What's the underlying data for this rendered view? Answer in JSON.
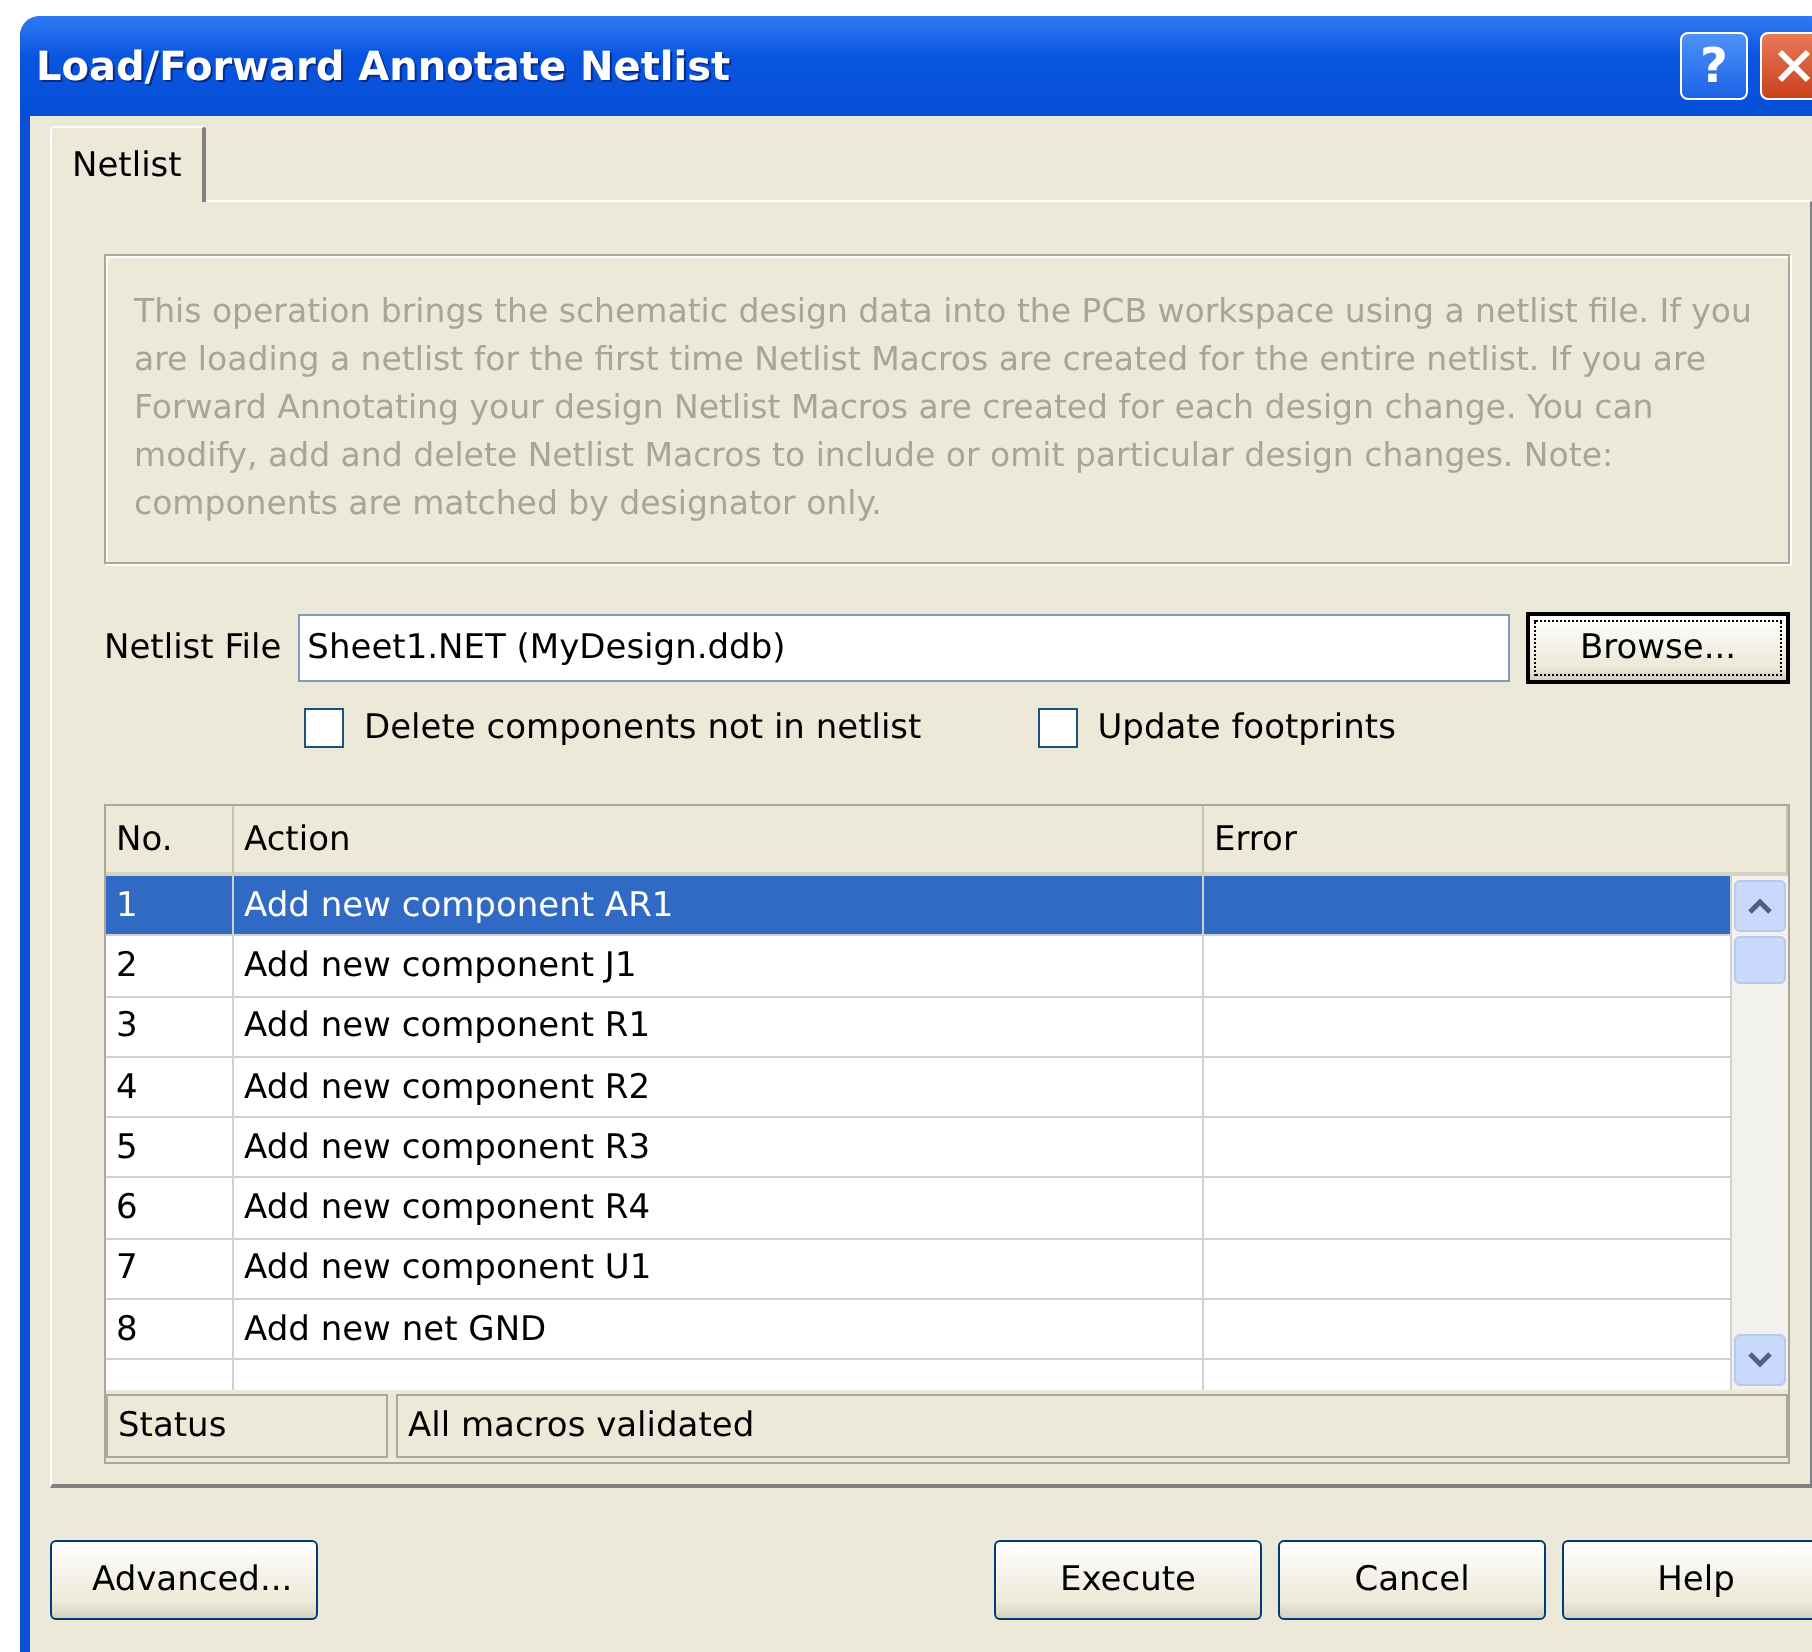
{
  "window": {
    "title": "Load/Forward Annotate Netlist",
    "buttons": [
      {
        "kind": "help",
        "label": "?"
      },
      {
        "kind": "close"
      }
    ]
  },
  "tabs": [
    {
      "label": "Netlist",
      "selected": true
    }
  ],
  "description": "This operation brings the schematic design data into the PCB workspace using a netlist file. If you are loading a netlist for the first time Netlist Macros are created for the entire netlist. If you are Forward Annotating your design Netlist Macros are created for each design change. You can modify, add and delete Netlist Macros to include or omit particular design changes.  Note: components are matched by designator only.",
  "netlist_file": {
    "label": "Netlist File",
    "value": "Sheet1.NET (MyDesign.ddb)",
    "button": "Browse..."
  },
  "options": [
    {
      "label": "Delete components not in netlist",
      "checked": false
    },
    {
      "label": "Update footprints",
      "checked": false
    }
  ],
  "table": {
    "columns": [
      "No.",
      "Action",
      "Error"
    ],
    "rows": [
      {
        "no": "1",
        "action": "Add new component AR1",
        "error": "",
        "selected": true
      },
      {
        "no": "2",
        "action": "Add new component J1",
        "error": "",
        "selected": false
      },
      {
        "no": "3",
        "action": "Add new component R1",
        "error": "",
        "selected": false
      },
      {
        "no": "4",
        "action": "Add new component R2",
        "error": "",
        "selected": false
      },
      {
        "no": "5",
        "action": "Add new component R3",
        "error": "",
        "selected": false
      },
      {
        "no": "6",
        "action": "Add new component R4",
        "error": "",
        "selected": false
      },
      {
        "no": "7",
        "action": "Add new component U1",
        "error": "",
        "selected": false
      },
      {
        "no": "8",
        "action": "Add new net GND",
        "error": "",
        "selected": false
      }
    ],
    "status_label": "Status",
    "status": "All macros validated"
  },
  "buttons_left": [
    "Advanced..."
  ],
  "buttons_right": [
    "Execute",
    "Cancel",
    "Help"
  ]
}
